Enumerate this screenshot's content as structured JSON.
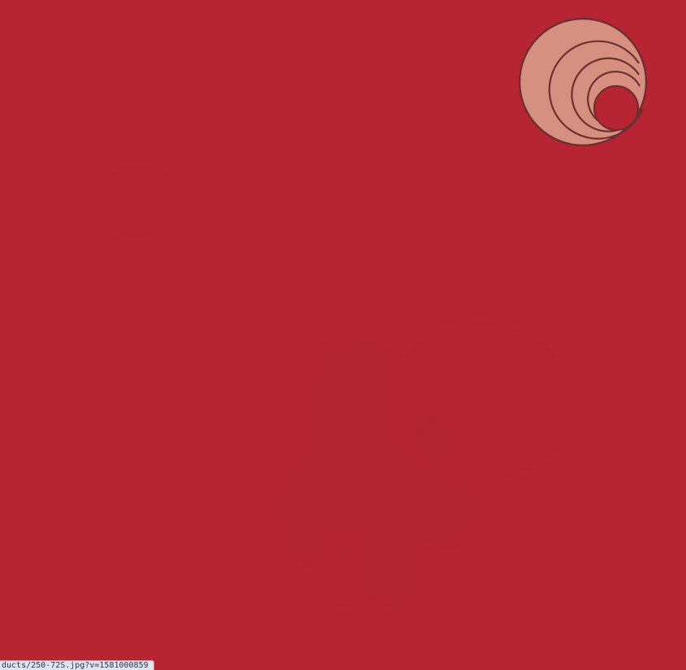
{
  "colors": {
    "swatch": "#b72533",
    "logo_fill": "#d6907f",
    "logo_stroke": "#6e2f2f",
    "status_bg": "#dfe6f3"
  },
  "logo": {
    "icon": "concentric-swirl-logo-icon"
  },
  "status_bar": {
    "url": "ducts/250-72S.jpg?v=1581000859"
  }
}
